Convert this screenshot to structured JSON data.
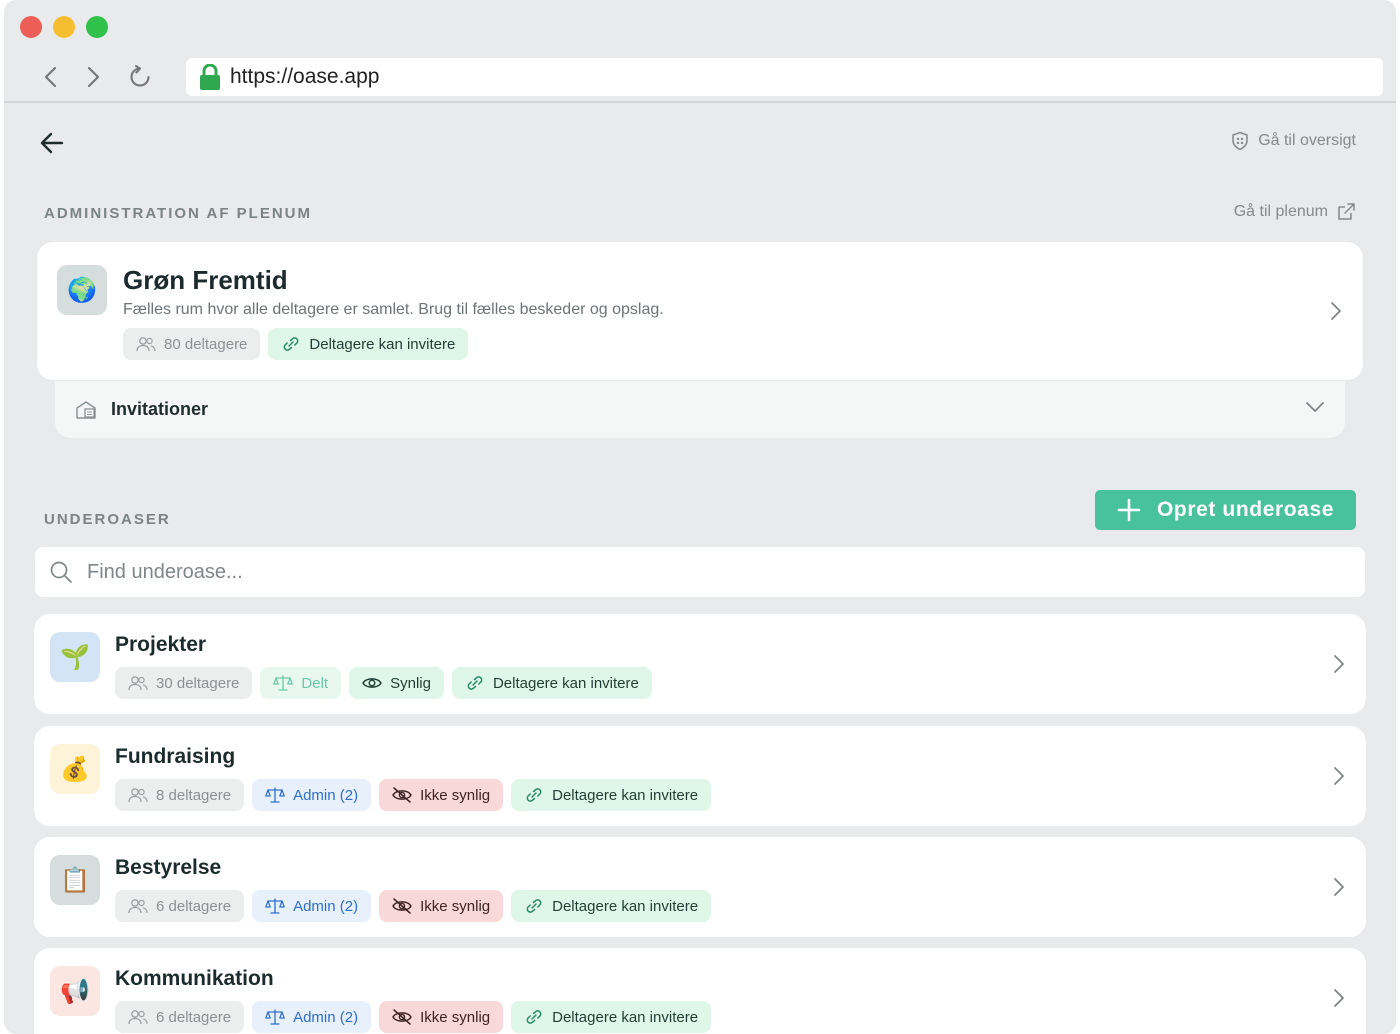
{
  "browser": {
    "url": "https://oase.app"
  },
  "header": {
    "overview_link": "Gå til oversigt"
  },
  "plenum_section": {
    "title": "ADMINISTRATION AF PLENUM",
    "goto_link": "Gå til plenum"
  },
  "plenum": {
    "icon": "earth-globe-icon",
    "emoji": "🌍",
    "name": "Grøn Fremtid",
    "description": "Fælles rum hvor alle deltagere er samlet. Brug til fælles beskeder og opslag.",
    "participants": "80 deltagere",
    "invite_badge": "Deltagere kan invitere",
    "avatar_color": "#d6dedd"
  },
  "invitations": {
    "label": "Invitationer"
  },
  "sub_section": {
    "title": "UNDEROASER",
    "create_button": "Opret underoase",
    "search_placeholder": "Find underoase..."
  },
  "sub_oases": [
    {
      "name": "Projekter",
      "emoji": "🌱",
      "icon": "seedling-icon",
      "avatar_color": "#d3e4f7",
      "participants": "30 deltagere",
      "role": "Delt",
      "visibility": "Synlig",
      "invite": "Deltagere kan invitere"
    },
    {
      "name": "Fundraising",
      "emoji": "💰",
      "icon": "money-bag-icon",
      "avatar_color": "#fcf3d8",
      "participants": "8 deltagere",
      "role": "Admin (2)",
      "visibility": "Ikke synlig",
      "invite": "Deltagere kan invitere"
    },
    {
      "name": "Bestyrelse",
      "emoji": "📋",
      "icon": "clipboard-icon",
      "avatar_color": "#d6dedd",
      "participants": "6 deltagere",
      "role": "Admin (2)",
      "visibility": "Ikke synlig",
      "invite": "Deltagere kan invitere"
    },
    {
      "name": "Kommunikation",
      "emoji": "📢",
      "icon": "megaphone-icon",
      "avatar_color": "#fbe6e2",
      "participants": "6 deltagere",
      "role": "Admin (2)",
      "visibility": "Ikke synlig",
      "invite": "Deltagere kan invitere"
    }
  ],
  "colors": {
    "accent": "#48c29a",
    "background": "#e9eaec",
    "card": "#ffffff"
  }
}
